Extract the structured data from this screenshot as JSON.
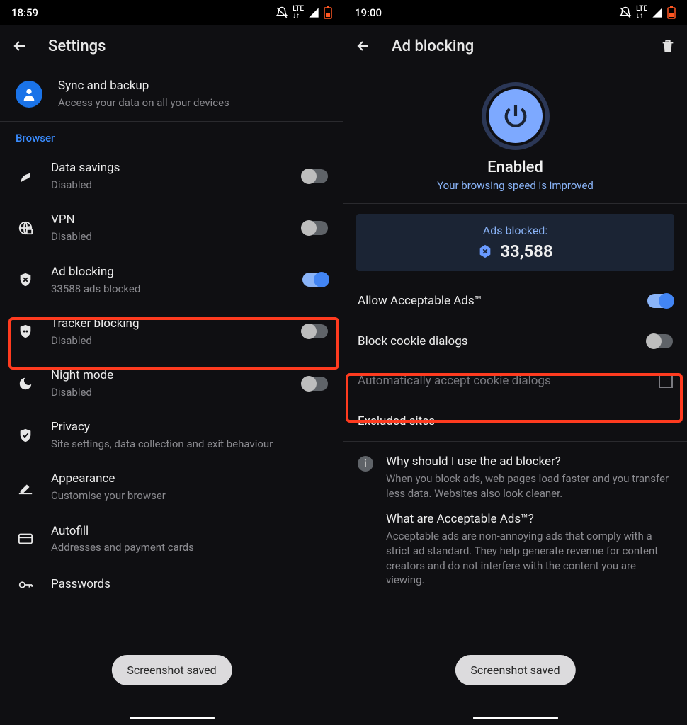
{
  "left": {
    "status_time": "18:59",
    "title": "Settings",
    "sync": {
      "title": "Sync and backup",
      "subtitle": "Access your data on all your devices"
    },
    "section": "Browser",
    "rows": {
      "data_savings": {
        "title": "Data savings",
        "subtitle": "Disabled"
      },
      "vpn": {
        "title": "VPN",
        "subtitle": "Disabled"
      },
      "ad_blocking": {
        "title": "Ad blocking",
        "subtitle": "33588 ads blocked"
      },
      "tracker": {
        "title": "Tracker blocking",
        "subtitle": "Disabled"
      },
      "night": {
        "title": "Night mode",
        "subtitle": "Disabled"
      },
      "privacy": {
        "title": "Privacy",
        "subtitle": "Site settings, data collection and exit behaviour"
      },
      "appearance": {
        "title": "Appearance",
        "subtitle": "Customise your browser"
      },
      "autofill": {
        "title": "Autofill",
        "subtitle": "Addresses and payment cards"
      },
      "passwords": {
        "title": "Passwords"
      }
    },
    "toast": "Screenshot saved"
  },
  "right": {
    "status_time": "19:00",
    "title": "Ad blocking",
    "enabled_title": "Enabled",
    "enabled_sub": "Your browsing speed is improved",
    "stat_label": "Ads blocked:",
    "stat_value": "33,588",
    "rows": {
      "acceptable": "Allow Acceptable Ads™",
      "block_cookie": "Block cookie dialogs",
      "auto_cookie": "Automatically accept cookie dialogs",
      "excluded": "Excluded sites"
    },
    "info1_title": "Why should I use the ad blocker?",
    "info1_body": "When you block ads, web pages load faster and you transfer less data. Websites also look cleaner.",
    "info2_title": "What are Acceptable Ads™?",
    "info2_body": "Acceptable ads are non-annoying ads that comply with a strict ad standard. They help generate revenue for content creators and do not interfere with the content you are viewing.",
    "toast": "Screenshot saved"
  }
}
